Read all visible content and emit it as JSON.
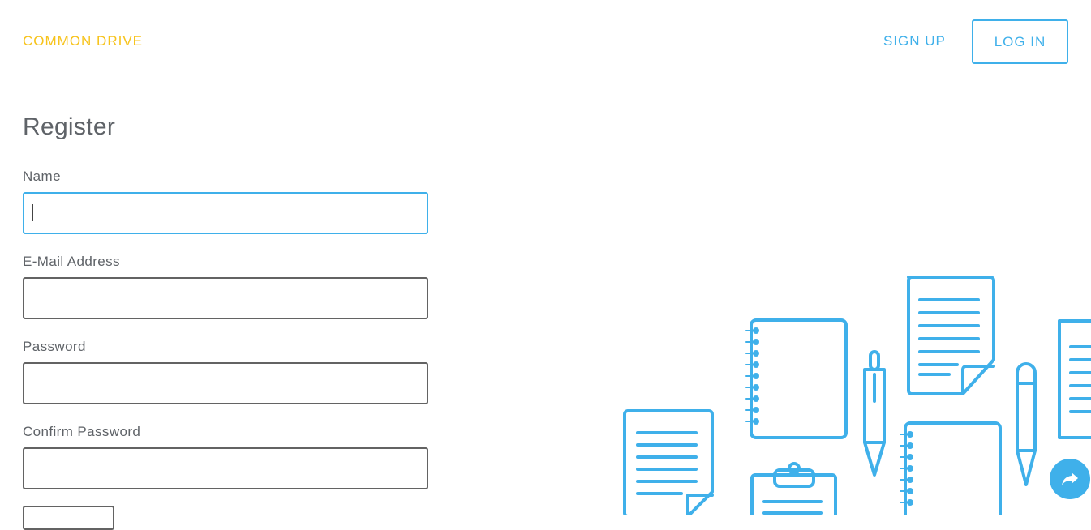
{
  "header": {
    "brand": "COMMON DRIVE",
    "sign_up": "SIGN UP",
    "log_in": "LOG IN"
  },
  "form": {
    "title": "Register",
    "name_label": "Name",
    "name_value": "",
    "email_label": "E-Mail Address",
    "email_value": "",
    "password_label": "Password",
    "password_value": "",
    "confirm_label": "Confirm Password",
    "confirm_value": ""
  },
  "icons": {
    "share": "share-icon",
    "illustration": "documents-illustration"
  },
  "colors": {
    "brand": "#f7c31b",
    "accent": "#3fb0ea",
    "text": "#5f6368"
  }
}
